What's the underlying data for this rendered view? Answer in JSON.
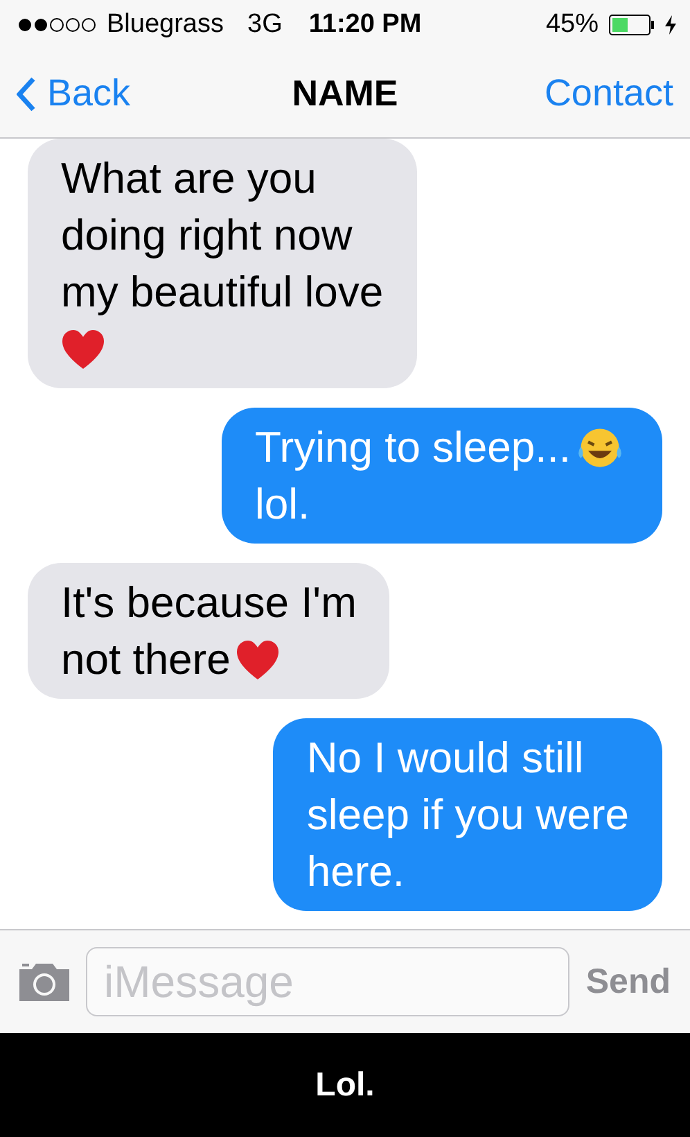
{
  "status_bar": {
    "carrier": "Bluegrass",
    "network": "3G",
    "time": "11:20 PM",
    "battery": "45%"
  },
  "nav_bar": {
    "back": "Back",
    "title": "NAME",
    "action": "Contact"
  },
  "messages": [
    {
      "kind": "incoming",
      "lines": [
        [
          {
            "kind": "text",
            "text": "What are you"
          }
        ],
        [
          {
            "kind": "text",
            "text": "doing right now"
          }
        ],
        [
          {
            "kind": "text",
            "text": "my beautiful love"
          }
        ],
        [
          {
            "kind": "heart"
          }
        ]
      ]
    },
    {
      "kind": "outgoing",
      "lines": [
        [
          {
            "kind": "text",
            "text": "Trying to sleep..."
          },
          {
            "kind": "laugh"
          }
        ],
        [
          {
            "kind": "text",
            "text": "lol."
          }
        ]
      ]
    },
    {
      "kind": "incoming",
      "lines": [
        [
          {
            "kind": "text",
            "text": "It's because I'm"
          }
        ],
        [
          {
            "kind": "text",
            "text": "not there"
          },
          {
            "kind": "heart"
          }
        ]
      ]
    },
    {
      "kind": "outgoing",
      "lines": [
        [
          {
            "kind": "text",
            "text": "No I would still"
          }
        ],
        [
          {
            "kind": "text",
            "text": "sleep if you were"
          }
        ],
        [
          {
            "kind": "text",
            "text": "here."
          }
        ]
      ]
    }
  ],
  "input_bar": {
    "placeholder": "iMessage",
    "send": "Send",
    "send_disabled": true
  },
  "caption": "Lol."
}
